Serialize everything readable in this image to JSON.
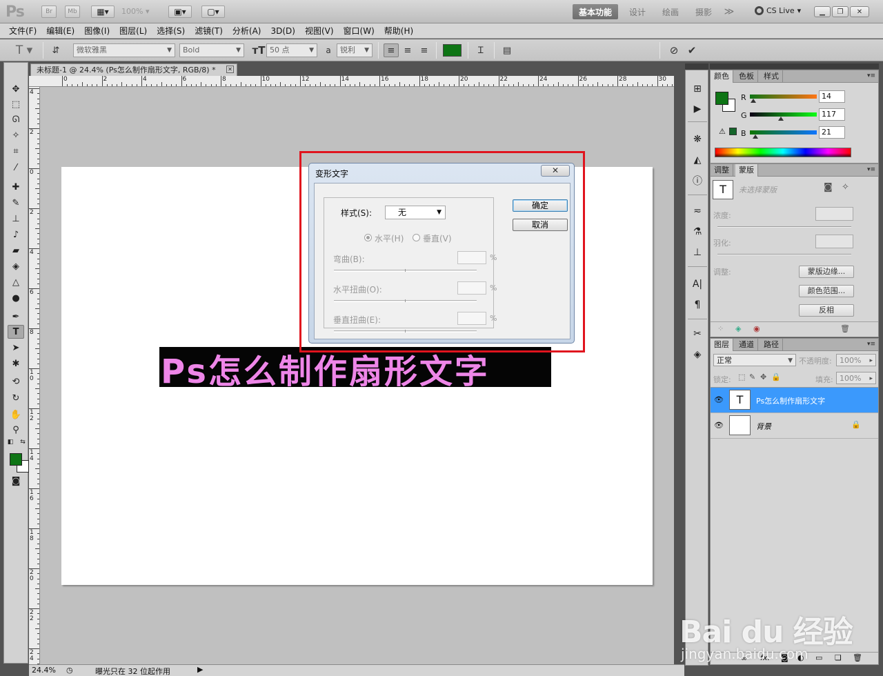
{
  "app": {
    "logo": "Ps",
    "bridge_btn": "Br",
    "minibridge_btn": "Mb",
    "zoom_level": "100%",
    "workspaces": [
      "基本功能",
      "设计",
      "绘画",
      "摄影"
    ],
    "more_workspaces": "≫",
    "cs_live": "CS Live"
  },
  "menu": [
    "文件(F)",
    "编辑(E)",
    "图像(I)",
    "图层(L)",
    "选择(S)",
    "滤镜(T)",
    "分析(A)",
    "3D(D)",
    "视图(V)",
    "窗口(W)",
    "帮助(H)"
  ],
  "options": {
    "font_family": "微软雅黑",
    "font_style": "Bold",
    "font_size": "50 点",
    "antialias_label": "a",
    "antialias": "锐利",
    "text_color": "#0e7515"
  },
  "document": {
    "tab_title": "未标题-1 @ 24.4% (Ps怎么制作扇形文字, RGB/8) *",
    "text": "Ps怎么制作扇形文字",
    "text_color": "#ee86e8",
    "ruler_top_labels": [
      "0",
      "2",
      "4",
      "6",
      "8",
      "10",
      "12",
      "14",
      "16",
      "18",
      "20",
      "22",
      "24",
      "26",
      "28",
      "30"
    ],
    "ruler_left_labels": [
      "4",
      "2",
      "0",
      "2",
      "4",
      "6",
      "8",
      "10",
      "12",
      "14",
      "16",
      "18",
      "20",
      "22",
      "24"
    ]
  },
  "dialog": {
    "title": "变形文字",
    "style_label": "样式(S):",
    "style_value": "无",
    "horizontal": "水平(H)",
    "vertical": "垂直(V)",
    "bend": "弯曲(B):",
    "h_distort": "水平扭曲(O):",
    "v_distort": "垂直扭曲(E):",
    "percent": "%",
    "ok": "确定",
    "cancel": "取消"
  },
  "color_panel": {
    "tabs": [
      "颜色",
      "色板",
      "样式"
    ],
    "r_label": "R",
    "g_label": "G",
    "b_label": "B",
    "r": "14",
    "g": "117",
    "b": "21",
    "r_fraction": 0.055,
    "g_fraction": 0.459,
    "b_fraction": 0.082,
    "fg": "#0e7515",
    "bg": "#ffffff"
  },
  "mask_panel": {
    "tabs": [
      "调整",
      "蒙版"
    ],
    "no_mask": "未选择蒙版",
    "density": "浓度:",
    "feather": "羽化:",
    "adjust": "调整:",
    "mask_edge": "蒙版边缘...",
    "color_range": "颜色范围...",
    "invert": "反相"
  },
  "layers_panel": {
    "tabs": [
      "图层",
      "通道",
      "路径"
    ],
    "blend_mode": "正常",
    "opacity_label": "不透明度:",
    "opacity": "100%",
    "lock_label": "锁定:",
    "fill_label": "填充:",
    "fill": "100%",
    "layers": [
      {
        "name": "Ps怎么制作扇形文字",
        "thumb": "T",
        "selected": true
      },
      {
        "name": "背景",
        "thumb": "",
        "selected": false
      }
    ]
  },
  "status": {
    "zoom": "24.4%",
    "info": "曝光只在 32 位起作用"
  },
  "watermark": {
    "logo": "Bai du 经验",
    "url": "jingyan.baidu.com"
  }
}
